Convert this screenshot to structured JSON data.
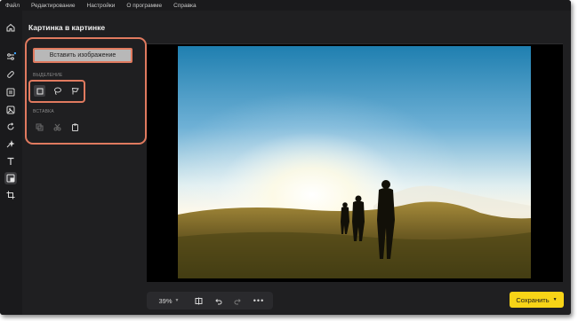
{
  "menu": [
    "Файл",
    "Редактирование",
    "Настройки",
    "О программе",
    "Справка"
  ],
  "panel": {
    "title": "Картинка в картинке",
    "insert_label": "Вставить изображение",
    "selection_label": "Выделение",
    "paste_label": "Вставка"
  },
  "sidebar_icons": [
    "home-icon",
    "adjust-icon",
    "bandage-icon",
    "export-image-icon",
    "magic-image-icon",
    "rotate-icon",
    "sparkle-icon",
    "text-icon",
    "picture-in-picture-icon",
    "crop-icon"
  ],
  "toolbar": {
    "zoom": "39%",
    "save_label": "Сохранить"
  },
  "colors": {
    "highlight": "#e07a5f",
    "save": "#f7d417",
    "background": "#1f1f21"
  }
}
